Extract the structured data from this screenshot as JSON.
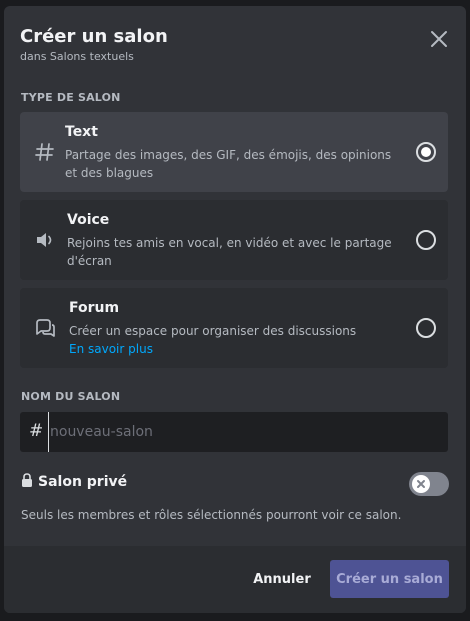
{
  "header": {
    "title": "Créer un salon",
    "subtitle": "dans Salons textuels"
  },
  "channel_type": {
    "label": "TYPE DE SALON",
    "options": [
      {
        "title": "Text",
        "description": "Partage des images, des GIF, des émojis, des opinions et des blagues",
        "icon": "hash-icon",
        "selected": true
      },
      {
        "title": "Voice",
        "description": "Rejoins tes amis en vocal, en vidéo et avec le partage d'écran",
        "icon": "speaker-icon",
        "selected": false
      },
      {
        "title": "Forum",
        "description": "Créer un espace pour organiser des discussions",
        "link": "En savoir plus",
        "icon": "forum-icon",
        "selected": false
      }
    ]
  },
  "channel_name": {
    "label": "NOM DU SALON",
    "prefix": "#",
    "placeholder": "nouveau-salon",
    "value": ""
  },
  "private": {
    "label": "Salon privé",
    "description": "Seuls les membres et rôles sélectionnés pourront voir ce salon.",
    "enabled": false
  },
  "footer": {
    "cancel_label": "Annuler",
    "create_label": "Créer un salon"
  },
  "colors": {
    "modal_bg": "#313338",
    "selected_bg": "#404249",
    "option_bg": "#2b2d31",
    "link": "#00a8fc",
    "create_button": "#4e5394"
  }
}
